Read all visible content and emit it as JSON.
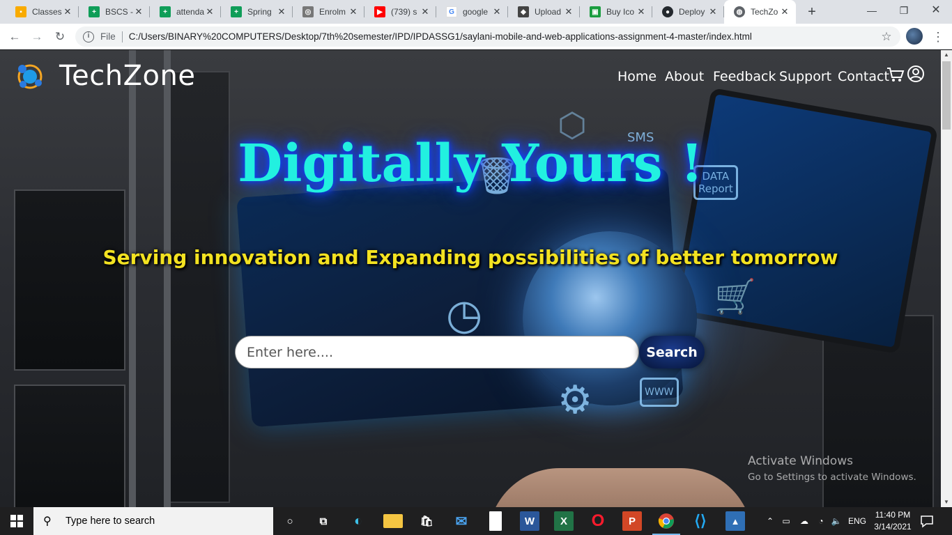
{
  "browser": {
    "tabs": [
      {
        "title": "Classes",
        "favicon": "classroom-icon",
        "color": "#f9ab00",
        "active": false
      },
      {
        "title": "BSCS -",
        "favicon": "sheets-icon",
        "color": "#0f9d58",
        "active": false
      },
      {
        "title": "attenda",
        "favicon": "sheets-icon",
        "color": "#0f9d58",
        "active": false
      },
      {
        "title": "Spring",
        "favicon": "sheets-icon",
        "color": "#0f9d58",
        "active": false
      },
      {
        "title": "Enrolm",
        "favicon": "university-icon",
        "color": "#555555",
        "active": false
      },
      {
        "title": "(739) s",
        "favicon": "youtube-icon",
        "color": "#ff0000",
        "active": false
      },
      {
        "title": "google",
        "favicon": "google-icon",
        "color": "#4285f4",
        "active": false
      },
      {
        "title": "Upload",
        "favicon": "upload-icon",
        "color": "#444444",
        "active": false
      },
      {
        "title": "Buy Ico",
        "favicon": "buy-icon",
        "color": "#1a9d3f",
        "active": false
      },
      {
        "title": "Deploy",
        "favicon": "github-icon",
        "color": "#24292e",
        "active": false
      },
      {
        "title": "TechZo",
        "favicon": "globe-icon",
        "color": "#5f6368",
        "active": true
      }
    ],
    "new_tab": "+",
    "address": {
      "scheme_label": "File",
      "url": "C:/Users/BINARY%20COMPUTERS/Desktop/7th%20semester/IPD/IPDASSG1/saylani-mobile-and-web-applications-assignment-4-master/index.html"
    }
  },
  "site": {
    "brand": "TechZone",
    "nav": [
      {
        "label": "Home"
      },
      {
        "label": "About"
      },
      {
        "label": "Feedback"
      },
      {
        "label": "Support"
      },
      {
        "label": "Contact"
      }
    ],
    "hero": {
      "title": "Digitally Yours !",
      "subtitle": "Serving innovation and Expanding possibilities of better tomorrow"
    },
    "search": {
      "placeholder": "Enter here....",
      "button_label": "Search"
    },
    "colors": {
      "title": "#22f0e0",
      "subtitle": "#f3e221",
      "button": "#0b1f5c"
    }
  },
  "activation": {
    "line1": "Activate Windows",
    "line2": "Go to Settings to activate Windows."
  },
  "taskbar": {
    "search_placeholder": "Type here to search",
    "language": "ENG",
    "time": "11:40 PM",
    "date": "3/14/2021",
    "apps": [
      {
        "name": "cortana-icon"
      },
      {
        "name": "task-view-icon"
      },
      {
        "name": "edge-icon"
      },
      {
        "name": "file-explorer-icon"
      },
      {
        "name": "store-icon"
      },
      {
        "name": "mail-icon"
      },
      {
        "name": "notepad-icon"
      },
      {
        "name": "word-icon"
      },
      {
        "name": "excel-icon"
      },
      {
        "name": "opera-icon"
      },
      {
        "name": "powerpoint-icon"
      },
      {
        "name": "chrome-icon"
      },
      {
        "name": "vscode-icon"
      },
      {
        "name": "photos-icon"
      }
    ]
  }
}
